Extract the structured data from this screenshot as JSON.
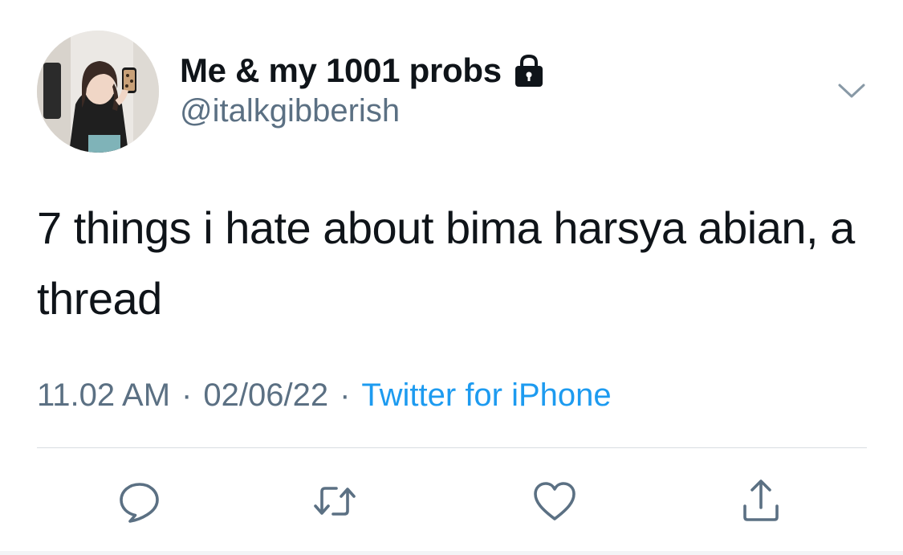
{
  "user": {
    "display_name": "Me & my 1001 probs",
    "handle": "@italkgibberish",
    "protected_icon": "lock-icon"
  },
  "tweet": {
    "text": "7 things i hate about bima harsya abian, a thread",
    "time": "11.02 AM",
    "date": "02/06/22",
    "separator": "·",
    "source": "Twitter for iPhone"
  },
  "actions": {
    "reply_icon": "reply-icon",
    "retweet_icon": "retweet-icon",
    "like_icon": "heart-icon",
    "share_icon": "share-icon"
  },
  "colors": {
    "text": "#0f1419",
    "secondary": "#5b7083",
    "accent": "#1d9bf0",
    "divider": "#d9dde1"
  }
}
